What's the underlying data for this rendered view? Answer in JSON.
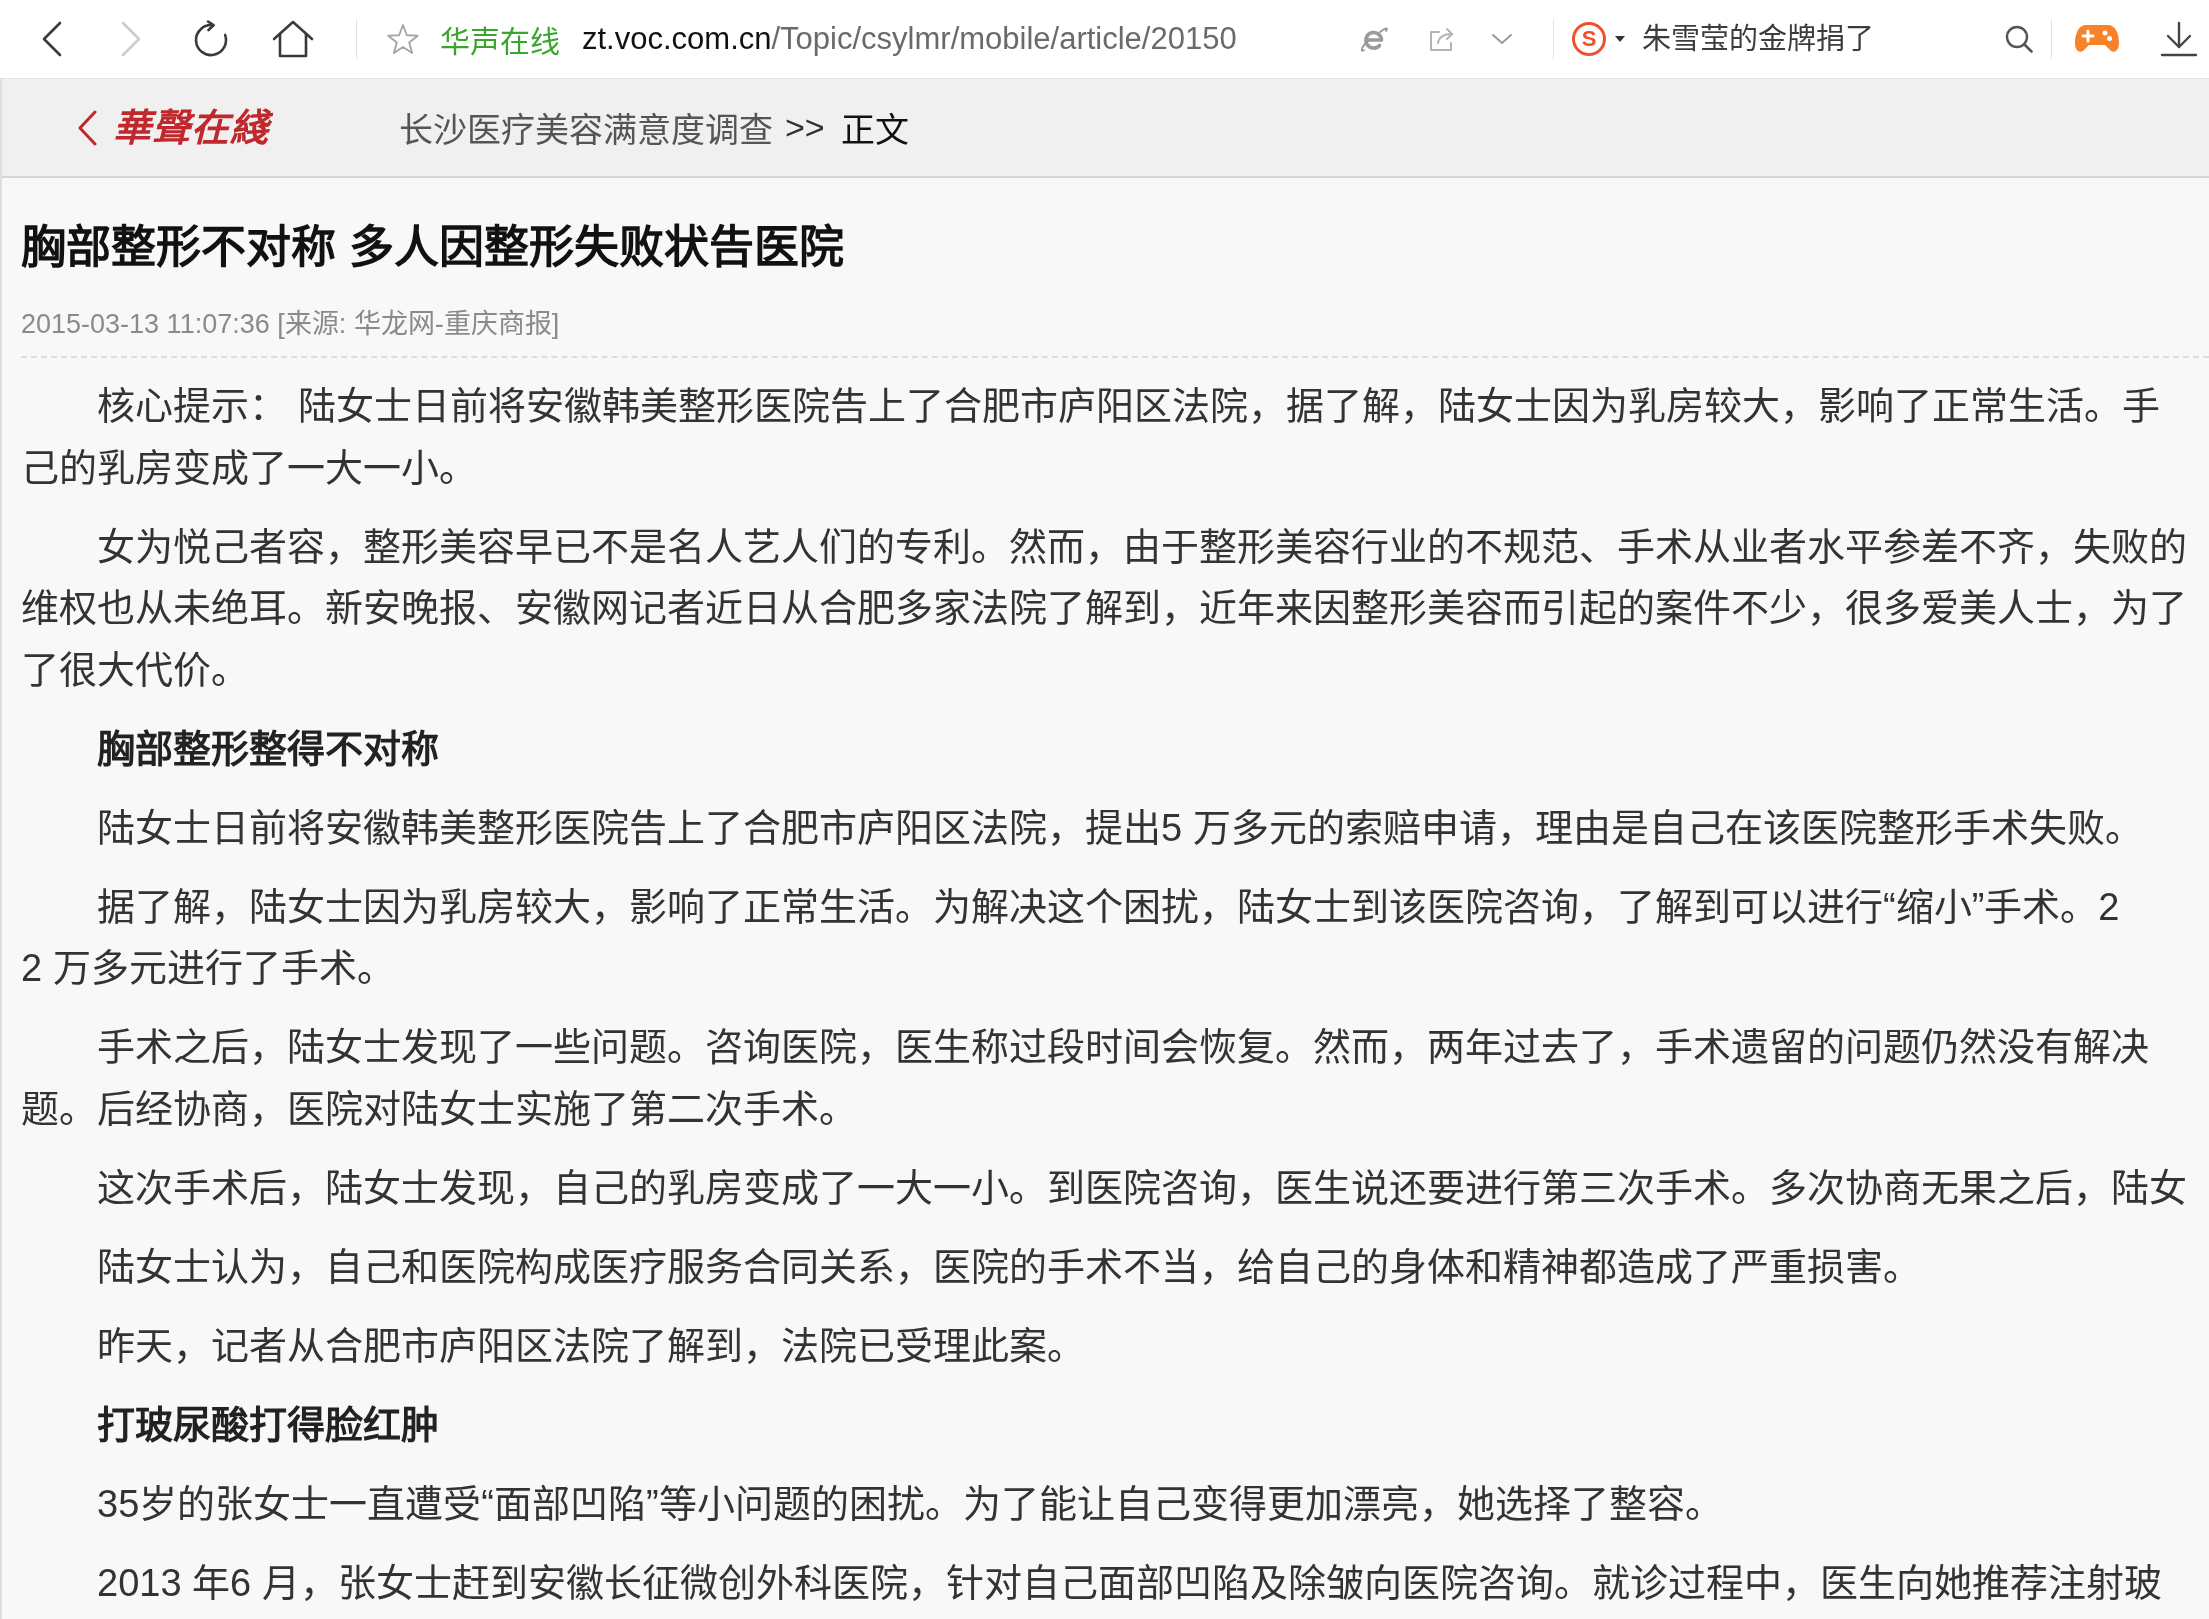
{
  "browser": {
    "nav": [
      {
        "kind": "back",
        "disabled": false
      },
      {
        "kind": "forward",
        "disabled": true
      },
      {
        "kind": "refresh",
        "disabled": false
      },
      {
        "kind": "home",
        "disabled": false
      }
    ],
    "site_name": "华声在线",
    "url": {
      "host": "zt.voc.com.cn",
      "path": "/Topic/csylmr/mobile/article/20150"
    },
    "search_engine_logo": "S",
    "search": {
      "placeholder": "朱雪莹的金牌捐了"
    }
  },
  "header": {
    "logo": "華聲在綫",
    "breadcrumb": [
      {
        "label": "长沙医疗美容满意度调查",
        "current": false
      },
      {
        "label": "正文",
        "current": true
      }
    ],
    "separator": ">>"
  },
  "article": {
    "title": "胸部整形不对称 多人因整形失败状告医院",
    "meta": "2015-03-13 11:07:36 [来源: 华龙网-重庆商报]",
    "blocks": [
      {
        "kind": "paragraph",
        "lines": [
          "核心提示： 陆女士日前将安徽韩美整形医院告上了合肥市庐阳区法院，据了解，陆女士因为乳房较大，影响了正常生活。手",
          "己的乳房变成了一大一小。"
        ]
      },
      {
        "kind": "paragraph",
        "lines": [
          "女为悦己者容，整形美容早已不是名人艺人们的专利。然而，由于整形美容行业的不规范、手术从业者水平参差不齐，失败的",
          "维权也从未绝耳。新安晚报、安徽网记者近日从合肥多家法院了解到，近年来因整形美容而引起的案件不少，很多爱美人士，为了",
          "了很大代价。"
        ]
      },
      {
        "kind": "heading",
        "text": "胸部整形整得不对称"
      },
      {
        "kind": "paragraph",
        "lines": [
          "陆女士日前将安徽韩美整形医院告上了合肥市庐阳区法院，提出5 万多元的索赔申请，理由是自己在该医院整形手术失败。"
        ]
      },
      {
        "kind": "paragraph",
        "lines": [
          "据了解，陆女士因为乳房较大，影响了正常生活。为解决这个困扰，陆女士到该医院咨询，了解到可以进行“缩小”手术。2",
          "2 万多元进行了手术。"
        ]
      },
      {
        "kind": "paragraph",
        "lines": [
          "手术之后，陆女士发现了一些问题。咨询医院，医生称过段时间会恢复。然而，两年过去了，手术遗留的问题仍然没有解决",
          "题。后经协商，医院对陆女士实施了第二次手术。"
        ]
      },
      {
        "kind": "paragraph",
        "lines": [
          "这次手术后，陆女士发现，自己的乳房变成了一大一小。到医院咨询，医生说还要进行第三次手术。多次协商无果之后，陆女"
        ]
      },
      {
        "kind": "paragraph",
        "lines": [
          "陆女士认为，自己和医院构成医疗服务合同关系，医院的手术不当，给自己的身体和精神都造成了严重损害。"
        ]
      },
      {
        "kind": "paragraph",
        "lines": [
          "昨天，记者从合肥市庐阳区法院了解到，法院已受理此案。"
        ]
      },
      {
        "kind": "heading",
        "text": "打玻尿酸打得脸红肿"
      },
      {
        "kind": "paragraph",
        "lines": [
          "35岁的张女士一直遭受“面部凹陷”等小问题的困扰。为了能让自己变得更加漂亮，她选择了整容。"
        ]
      },
      {
        "kind": "paragraph",
        "lines": [
          "2013 年6 月，张女士赶到安徽长征微创外科医院，针对自己面部凹陷及除皱向医院咨询。就诊过程中，医生向她推荐注射玻"
        ]
      }
    ]
  }
}
